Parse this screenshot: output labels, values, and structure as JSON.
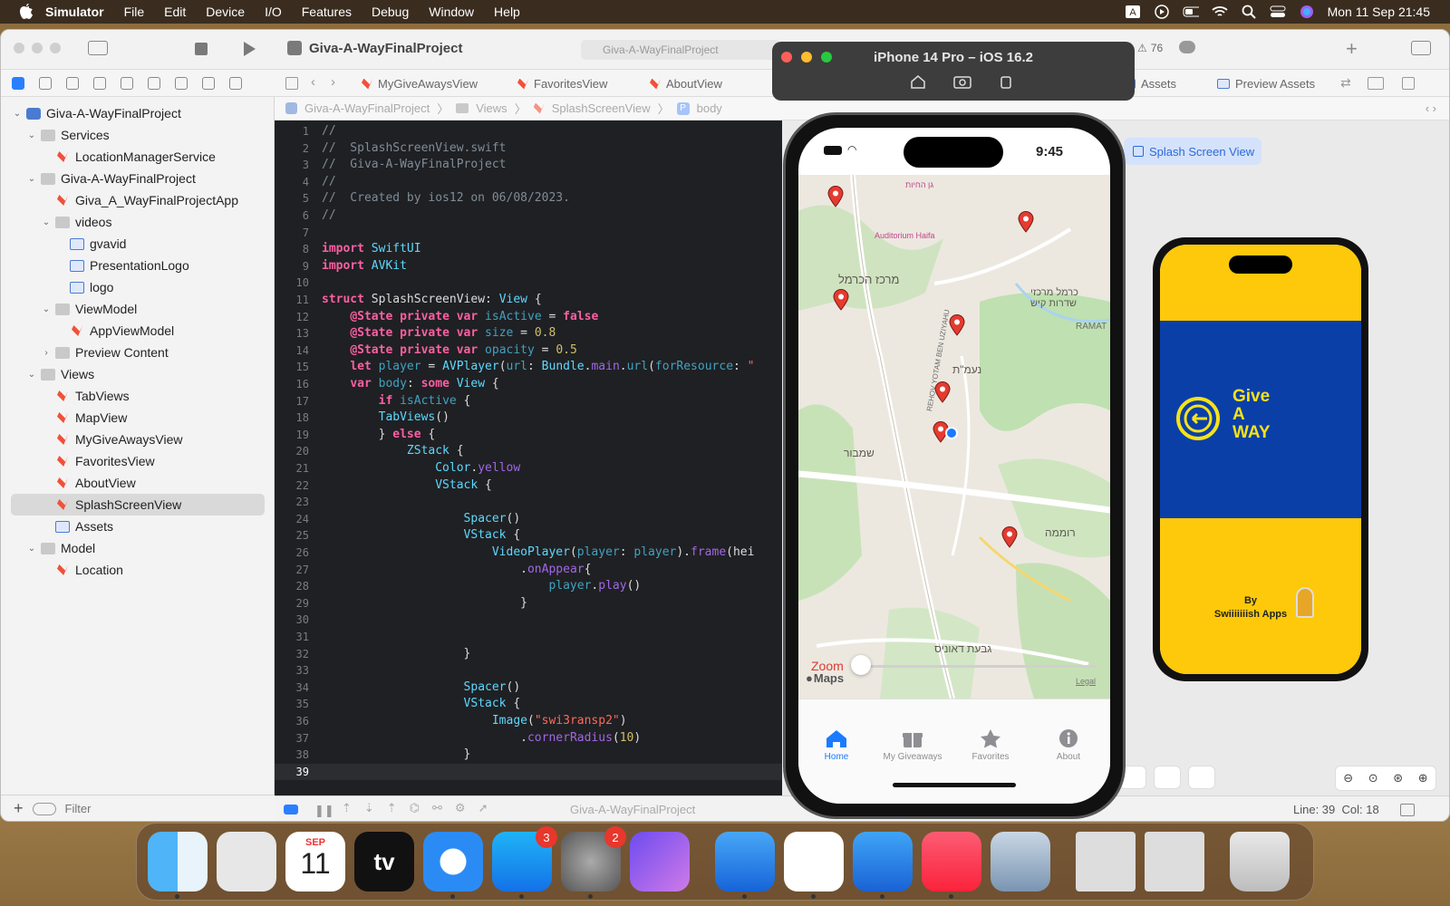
{
  "menubar": {
    "app_name": "Simulator",
    "items": [
      "File",
      "Edit",
      "Device",
      "I/O",
      "Features",
      "Debug",
      "Window",
      "Help"
    ],
    "clock": "Mon 11 Sep  21:45"
  },
  "xcode": {
    "project_title": "Giva-A-WayFinalProject",
    "scheme_crumb": "Giva-A-WayFinalProject",
    "warnings_count": "76",
    "tabs": [
      "MyGiveAwaysView",
      "FavoritesView",
      "AboutView",
      "Assets",
      "Preview Assets"
    ],
    "jumpbar": [
      "Giva-A-WayFinalProject",
      "Views",
      "SplashScreenView",
      "body"
    ],
    "navigator": [
      {
        "label": "Giva-A-WayFinalProject",
        "depth": 0,
        "kind": "project",
        "open": true
      },
      {
        "label": "Services",
        "depth": 1,
        "kind": "folder",
        "open": true
      },
      {
        "label": "LocationManagerService",
        "depth": 2,
        "kind": "swift"
      },
      {
        "label": "Giva-A-WayFinalProject",
        "depth": 1,
        "kind": "folder",
        "open": true
      },
      {
        "label": "Giva_A_WayFinalProjectApp",
        "depth": 2,
        "kind": "swift"
      },
      {
        "label": "videos",
        "depth": 2,
        "kind": "folder",
        "open": true
      },
      {
        "label": "gvavid",
        "depth": 3,
        "kind": "asset"
      },
      {
        "label": "PresentationLogo",
        "depth": 3,
        "kind": "asset"
      },
      {
        "label": "logo",
        "depth": 3,
        "kind": "asset"
      },
      {
        "label": "ViewModel",
        "depth": 2,
        "kind": "folder",
        "open": true
      },
      {
        "label": "AppViewModel",
        "depth": 3,
        "kind": "swift"
      },
      {
        "label": "Preview Content",
        "depth": 2,
        "kind": "folder",
        "open": false
      },
      {
        "label": "Views",
        "depth": 1,
        "kind": "folder",
        "open": true
      },
      {
        "label": "TabViews",
        "depth": 2,
        "kind": "swift"
      },
      {
        "label": "MapView",
        "depth": 2,
        "kind": "swift"
      },
      {
        "label": "MyGiveAwaysView",
        "depth": 2,
        "kind": "swift"
      },
      {
        "label": "FavoritesView",
        "depth": 2,
        "kind": "swift"
      },
      {
        "label": "AboutView",
        "depth": 2,
        "kind": "swift"
      },
      {
        "label": "SplashScreenView",
        "depth": 2,
        "kind": "swift",
        "selected": true
      },
      {
        "label": "Assets",
        "depth": 2,
        "kind": "assets"
      },
      {
        "label": "Model",
        "depth": 1,
        "kind": "folder",
        "open": true
      },
      {
        "label": "Location",
        "depth": 2,
        "kind": "swift"
      }
    ],
    "filter_placeholder": "Filter",
    "status": {
      "position": "Line: 39  Col: 18",
      "scheme": "Giva-A-WayFinalProject"
    },
    "canvas_chip": "Splash Screen View",
    "code": [
      "//",
      "//  SplashScreenView.swift",
      "//  Giva-A-WayFinalProject",
      "//",
      "//  Created by ios12 on 06/08/2023.",
      "//",
      "",
      "import SwiftUI",
      "import AVKit",
      "",
      "struct SplashScreenView: View {",
      "    @State private var isActive = false",
      "    @State private var size = 0.8",
      "    @State private var opacity = 0.5",
      "    let player = AVPlayer(url: Bundle.main.url(forResource: \"",
      "    var body: some View {",
      "        if isActive {",
      "        TabViews()",
      "        } else {",
      "            ZStack {",
      "                Color.yellow",
      "                VStack {",
      "",
      "                    Spacer()",
      "                    VStack {",
      "                        VideoPlayer(player: player).frame(hei",
      "                            .onAppear{",
      "                                player.play()",
      "                            }",
      "",
      "",
      "                    }",
      "",
      "                    Spacer()",
      "                    VStack {",
      "                        Image(\"swi3ransp2\")",
      "                            .cornerRadius(10)",
      "                    }",
      ""
    ]
  },
  "simulator": {
    "window_title": "iPhone 14 Pro – iOS 16.2",
    "time": "9:45",
    "zoom_label": "Zoom",
    "maps_label": "Maps",
    "legal_label": "Legal",
    "map_labels": [
      "מרכז הכרמל",
      "נעמ\"ת",
      "שמבור",
      "רוממה",
      "גבעת דאוניס",
      "כרמל מרכזי",
      "שדרות קיש",
      "RAMAT",
      "REHOV YOTAM BEN UZIYAHU",
      "Auditorium Haifa",
      "גן החיות"
    ],
    "tabs": [
      {
        "label": "Home",
        "active": true,
        "icon": "house-icon"
      },
      {
        "label": "My Giveaways",
        "active": false,
        "icon": "gift-icon"
      },
      {
        "label": "Favorites",
        "active": false,
        "icon": "star-icon"
      },
      {
        "label": "About",
        "active": false,
        "icon": "info-icon"
      }
    ]
  },
  "preview": {
    "logo_text": [
      "Give",
      "A",
      "WAY"
    ],
    "by_line": "By",
    "company": "Swiiiiiiish Apps",
    "colors": {
      "yellow": "#fdc90a",
      "blue": "#0b3fa8",
      "logo_yellow": "#f6e21a"
    }
  },
  "dock": {
    "apps": [
      {
        "name": "Finder",
        "icon": "finder-icon"
      },
      {
        "name": "Launchpad",
        "icon": "launchpad-icon"
      },
      {
        "name": "Calendar",
        "icon": "calendar-icon",
        "month": "SEP",
        "day": "11"
      },
      {
        "name": "Apple TV",
        "icon": "tv-icon",
        "text": "tv"
      },
      {
        "name": "Safari",
        "icon": "safari-icon"
      },
      {
        "name": "App Store",
        "icon": "appstore-icon",
        "badge": "3"
      },
      {
        "name": "System Settings",
        "icon": "settings-icon",
        "badge": "2"
      },
      {
        "name": "Assistant",
        "icon": "assistant-icon"
      },
      {
        "name": "Xcode",
        "icon": "xcode-icon"
      },
      {
        "name": "Slack",
        "icon": "slack-icon"
      },
      {
        "name": "Simulator",
        "icon": "simulator-icon"
      },
      {
        "name": "Music",
        "icon": "music-icon"
      },
      {
        "name": "Preview",
        "icon": "preview-icon"
      },
      {
        "name": "Window 1",
        "icon": "window-thumb-icon"
      },
      {
        "name": "Window 2",
        "icon": "window-thumb-icon"
      },
      {
        "name": "Trash",
        "icon": "trash-icon"
      }
    ]
  }
}
